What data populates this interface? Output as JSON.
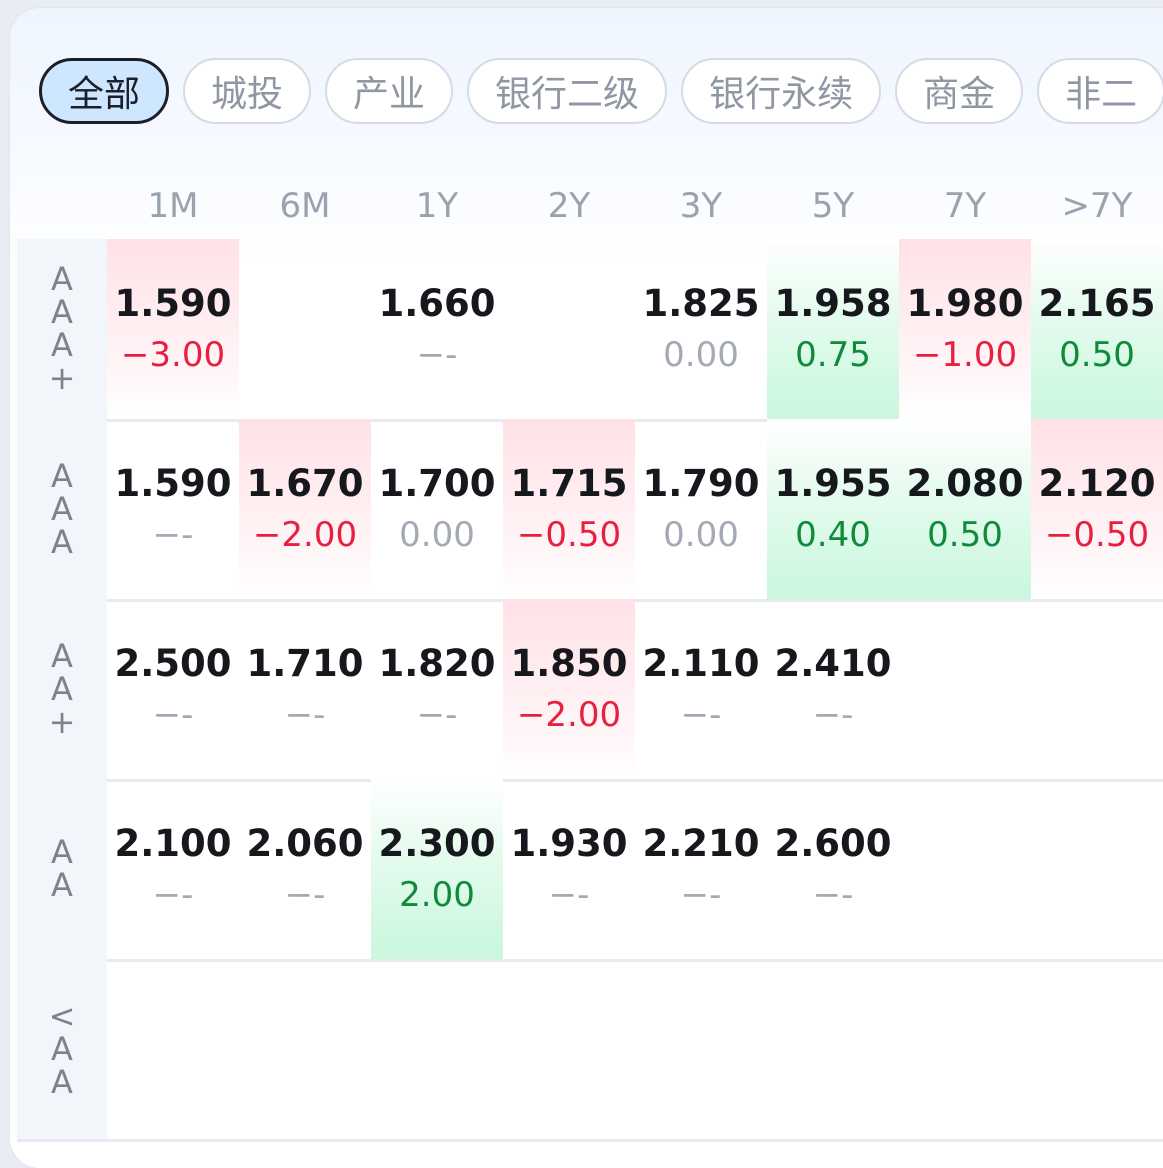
{
  "tabs": [
    {
      "label": "全部",
      "active": true
    },
    {
      "label": "城投",
      "active": false
    },
    {
      "label": "产业",
      "active": false
    },
    {
      "label": "银行二级",
      "active": false
    },
    {
      "label": "银行永续",
      "active": false
    },
    {
      "label": "商金",
      "active": false
    },
    {
      "label": "非二",
      "active": false
    }
  ],
  "columns": [
    "1M",
    "6M",
    "1Y",
    "2Y",
    "3Y",
    "5Y",
    "7Y",
    ">7Y"
  ],
  "rows": [
    {
      "label": "AAA+",
      "cells": [
        {
          "value": "1.590",
          "change": "-3.00",
          "tone": "neg",
          "bg": "red"
        },
        {
          "value": "",
          "change": "",
          "tone": "",
          "bg": ""
        },
        {
          "value": "1.660",
          "change": "--",
          "tone": "zero",
          "bg": ""
        },
        {
          "value": "",
          "change": "",
          "tone": "",
          "bg": ""
        },
        {
          "value": "1.825",
          "change": "0.00",
          "tone": "zero",
          "bg": ""
        },
        {
          "value": "1.958",
          "change": "0.75",
          "tone": "pos",
          "bg": "green"
        },
        {
          "value": "1.980",
          "change": "-1.00",
          "tone": "neg",
          "bg": "red"
        },
        {
          "value": "2.165",
          "change": "0.50",
          "tone": "pos",
          "bg": "green"
        }
      ]
    },
    {
      "label": "AAA",
      "cells": [
        {
          "value": "1.590",
          "change": "--",
          "tone": "zero",
          "bg": ""
        },
        {
          "value": "1.670",
          "change": "-2.00",
          "tone": "neg",
          "bg": "red"
        },
        {
          "value": "1.700",
          "change": "0.00",
          "tone": "zero",
          "bg": ""
        },
        {
          "value": "1.715",
          "change": "-0.50",
          "tone": "neg",
          "bg": "red"
        },
        {
          "value": "1.790",
          "change": "0.00",
          "tone": "zero",
          "bg": ""
        },
        {
          "value": "1.955",
          "change": "0.40",
          "tone": "pos",
          "bg": "green"
        },
        {
          "value": "2.080",
          "change": "0.50",
          "tone": "pos",
          "bg": "green"
        },
        {
          "value": "2.120",
          "change": "-0.50",
          "tone": "neg",
          "bg": "red"
        }
      ]
    },
    {
      "label": "AA+",
      "cells": [
        {
          "value": "2.500",
          "change": "--",
          "tone": "zero",
          "bg": ""
        },
        {
          "value": "1.710",
          "change": "--",
          "tone": "zero",
          "bg": ""
        },
        {
          "value": "1.820",
          "change": "--",
          "tone": "zero",
          "bg": ""
        },
        {
          "value": "1.850",
          "change": "-2.00",
          "tone": "neg",
          "bg": "red"
        },
        {
          "value": "2.110",
          "change": "--",
          "tone": "zero",
          "bg": ""
        },
        {
          "value": "2.410",
          "change": "--",
          "tone": "zero",
          "bg": ""
        },
        {
          "value": "",
          "change": "",
          "tone": "",
          "bg": ""
        },
        {
          "value": "",
          "change": "",
          "tone": "",
          "bg": ""
        }
      ]
    },
    {
      "label": "AA",
      "cells": [
        {
          "value": "2.100",
          "change": "--",
          "tone": "zero",
          "bg": ""
        },
        {
          "value": "2.060",
          "change": "--",
          "tone": "zero",
          "bg": ""
        },
        {
          "value": "2.300",
          "change": "2.00",
          "tone": "pos",
          "bg": "green"
        },
        {
          "value": "1.930",
          "change": "--",
          "tone": "zero",
          "bg": ""
        },
        {
          "value": "2.210",
          "change": "--",
          "tone": "zero",
          "bg": ""
        },
        {
          "value": "2.600",
          "change": "--",
          "tone": "zero",
          "bg": ""
        },
        {
          "value": "",
          "change": "",
          "tone": "",
          "bg": ""
        },
        {
          "value": "",
          "change": "",
          "tone": "",
          "bg": ""
        }
      ]
    },
    {
      "label": "<AA",
      "cells": []
    }
  ],
  "colors": {
    "negative": "#e8203f",
    "positive": "#0f8a3a",
    "neutral": "#a4aab4",
    "active_tab_bg": "#cfe6ff"
  }
}
